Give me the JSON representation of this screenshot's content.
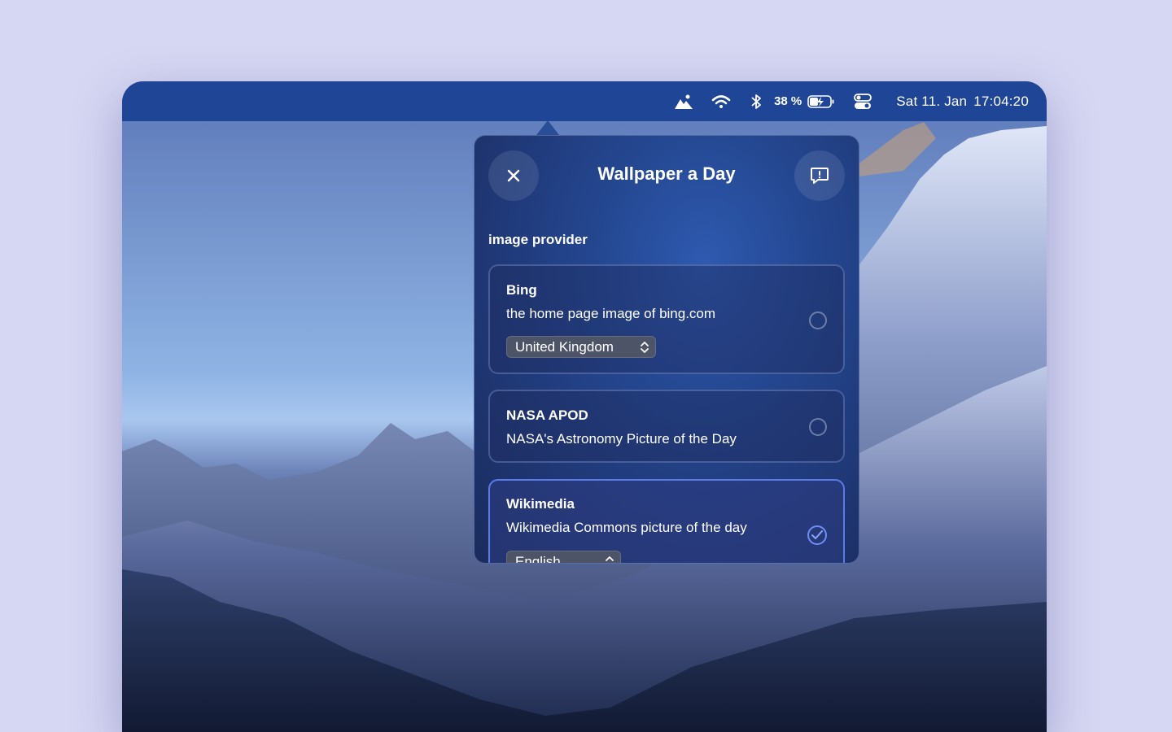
{
  "menubar": {
    "icons": [
      "mountain-icon",
      "wifi-icon",
      "bluetooth-icon",
      "battery-charging-icon",
      "control-center-icon"
    ],
    "battery_percent": "38 %",
    "date": "Sat 11. Jan",
    "time": "17:04:20"
  },
  "popover": {
    "title": "Wallpaper a Day",
    "close_icon": "close-icon",
    "feedback_icon": "feedback-icon",
    "section_label": "image provider",
    "providers": [
      {
        "name": "Bing",
        "description": "the home page image of bing.com",
        "selected": false,
        "option": "United Kingdom"
      },
      {
        "name": "NASA APOD",
        "description": "NASA's Astronomy Picture of the Day",
        "selected": false
      },
      {
        "name": "Wikimedia",
        "description": "Wikimedia Commons picture of the day",
        "selected": true,
        "option": "English"
      }
    ]
  },
  "colors": {
    "menubar": "#1f4596",
    "accent": "#5b7be8",
    "page_bg": "#d6d7f2"
  }
}
